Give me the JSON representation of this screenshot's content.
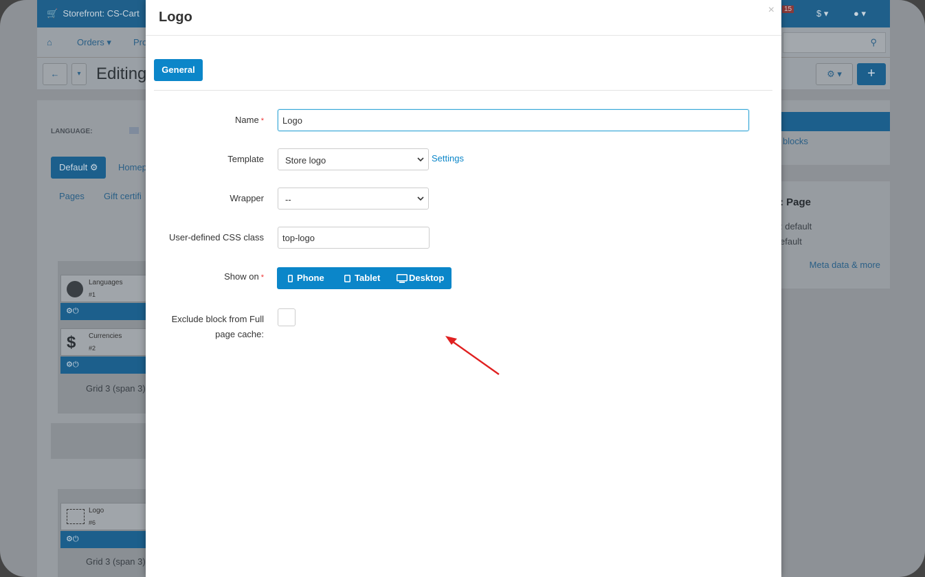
{
  "background": {
    "store_label": "Storefront: CS-Cart",
    "badge": "15",
    "currency": "$",
    "nav": [
      "Orders",
      "Pro"
    ],
    "editing_title": "Editing",
    "language_label": "LANGUAGE:",
    "tabs": {
      "default": "Default",
      "home": "Homep",
      "pages": "Pages",
      "gift": "Gift certifi"
    },
    "blocks": [
      {
        "name": "Languages",
        "number": "#1"
      },
      {
        "name": "Currencies",
        "number": "#2"
      },
      {
        "name": "Logo",
        "number": "#6"
      }
    ],
    "grid_label_1": "Grid 3 (span 3)",
    "grid_label_2": "Grid 3 (span 3)",
    "right_link": "blocks",
    "right_heading": ": Page",
    "right_line1": ": default",
    "right_line2": "efault",
    "meta_link": "Meta data & more"
  },
  "modal": {
    "title": "Logo",
    "close": "×",
    "tab_general": "General",
    "fields": {
      "name": {
        "label": "Name",
        "value": "Logo"
      },
      "template": {
        "label": "Template",
        "value": "Store logo",
        "settings_link": "Settings"
      },
      "wrapper": {
        "label": "Wrapper",
        "value": "--"
      },
      "css_class": {
        "label": "User-defined CSS class",
        "value": "top-logo"
      },
      "show_on": {
        "label": "Show on",
        "options": [
          "Phone",
          "Tablet",
          "Desktop"
        ]
      },
      "exclude": {
        "label_line1": "Exclude block from Full",
        "label_line2": "page cache:",
        "checked": false
      }
    },
    "required_mark": "*"
  },
  "colors": {
    "primary": "#0b86c9",
    "required": "#ee3333",
    "arrow": "#e02020"
  }
}
